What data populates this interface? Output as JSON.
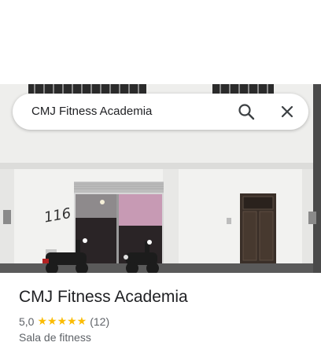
{
  "search": {
    "query": "CMJ Fitness Academia"
  },
  "place": {
    "name": "CMJ Fitness Academia",
    "rating": "5,0",
    "stars": "★★★★★",
    "review_count": "(12)",
    "category": "Sala de fitness",
    "facade_number": "116"
  },
  "colors": {
    "star": "#fbbc04",
    "text_primary": "#202124",
    "text_secondary": "#5f6368",
    "door": "#3a2f28",
    "wall": "#f1f1ef"
  },
  "icons": [
    "search-icon",
    "close-icon",
    "star-icon"
  ]
}
